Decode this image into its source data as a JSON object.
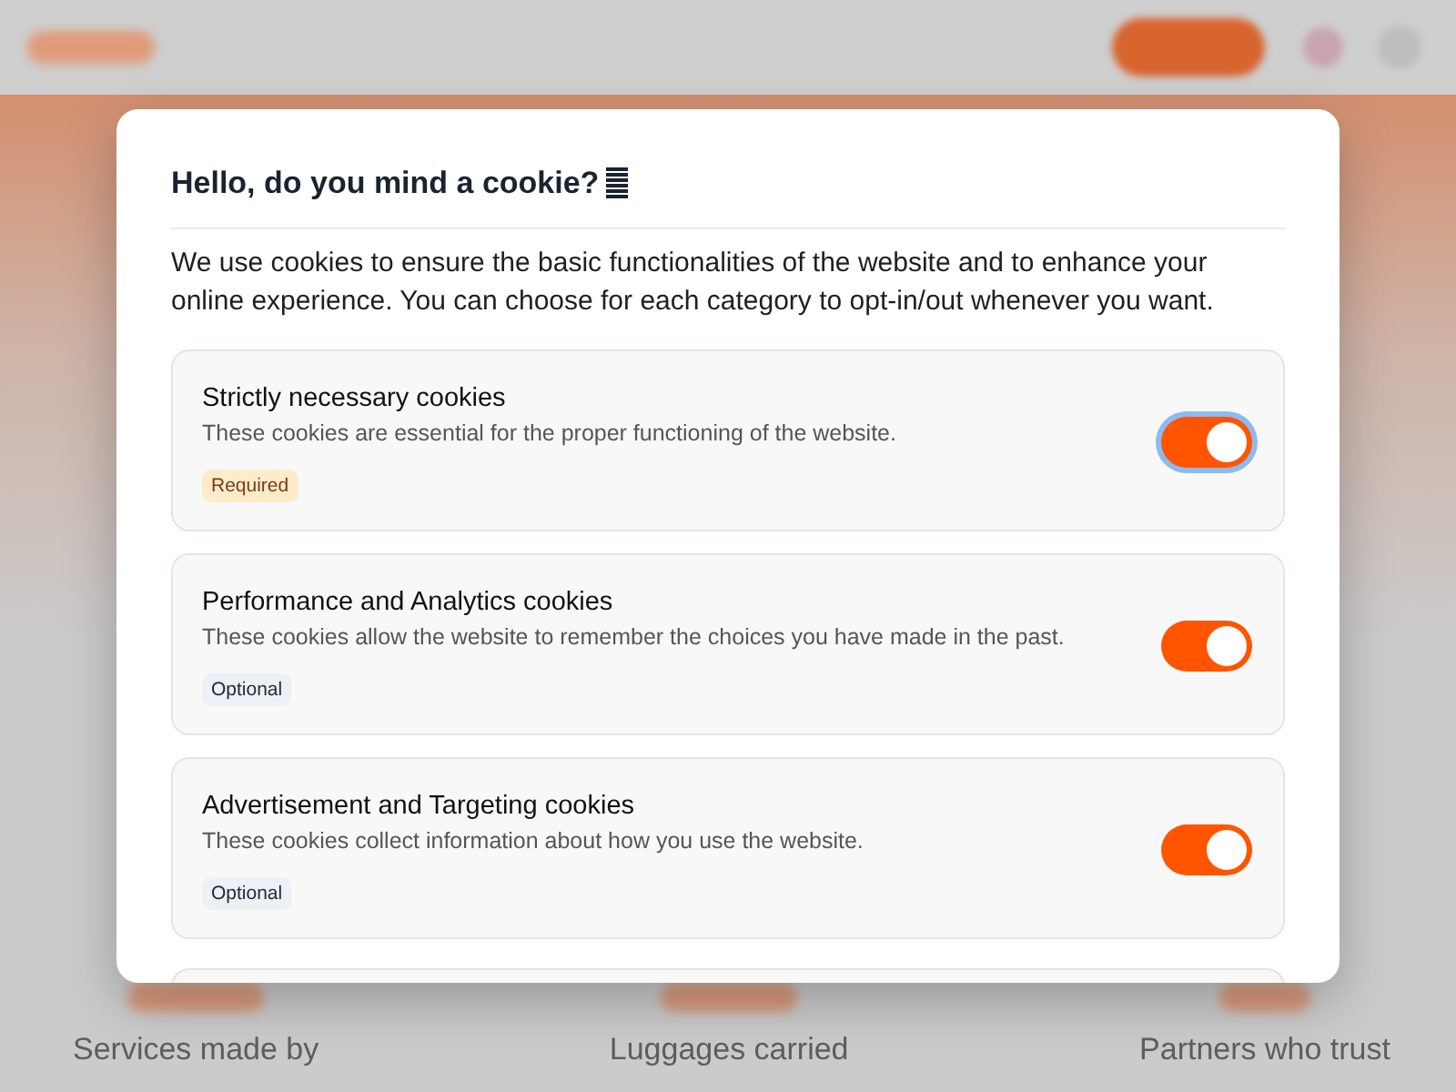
{
  "background": {
    "stats": [
      {
        "label": "Services made by"
      },
      {
        "label": "Luggages carried"
      },
      {
        "label": "Partners who trust"
      }
    ]
  },
  "modal": {
    "title": "Hello, do you mind a cookie?",
    "intro": "We use cookies to ensure the basic functionalities of the website and to enhance your online experience. You can choose for each category to opt-in/out whenever you want.",
    "categories": [
      {
        "title": "Strictly necessary cookies",
        "description": "These cookies are essential for the proper functioning of the website.",
        "tag": {
          "label": "Required",
          "kind": "required"
        },
        "on": true,
        "focused": true
      },
      {
        "title": "Performance and Analytics cookies",
        "description": "These cookies allow the website to remember the choices you have made in the past.",
        "tag": {
          "label": "Optional",
          "kind": "optional"
        },
        "on": true,
        "focused": false
      },
      {
        "title": "Advertisement and Targeting cookies",
        "description": "These cookies collect information about how you use the website.",
        "tag": {
          "label": "Optional",
          "kind": "optional"
        },
        "on": true,
        "focused": false
      }
    ]
  }
}
